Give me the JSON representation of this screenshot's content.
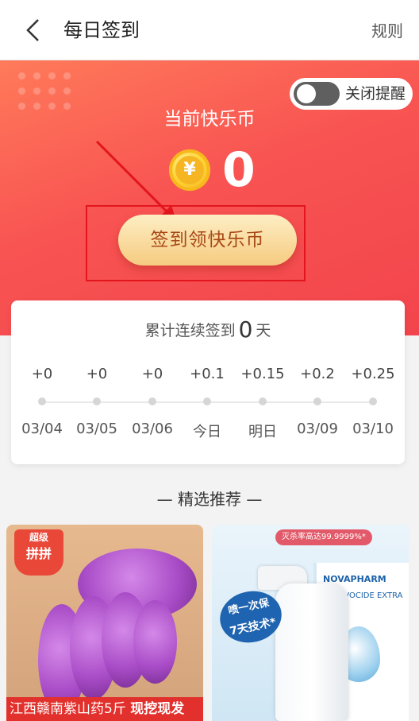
{
  "header": {
    "title": "每日签到",
    "rules_label": "规则"
  },
  "hero": {
    "remind_label": "关闭提醒",
    "remind_on": false,
    "balance_label": "当前快乐币",
    "coin_symbol": "¥",
    "balance": "0",
    "sign_button_label": "签到领快乐币"
  },
  "streak": {
    "prefix": "累计连续签到",
    "count": "0",
    "suffix": "天"
  },
  "schedule": [
    {
      "bonus": "+0",
      "date": "03/04"
    },
    {
      "bonus": "+0",
      "date": "03/05"
    },
    {
      "bonus": "+0",
      "date": "03/06"
    },
    {
      "bonus": "+0.1",
      "date": "今日"
    },
    {
      "bonus": "+0.15",
      "date": "明日"
    },
    {
      "bonus": "+0.2",
      "date": "03/09"
    },
    {
      "bonus": "+0.25",
      "date": "03/10"
    }
  ],
  "recommend": {
    "title": "— 精选推荐 —",
    "products": [
      {
        "badge_line1": "超级",
        "badge_line2": "拼拼",
        "caption": "江西赣南紫山药5斤",
        "caption_tag": "现挖现发"
      },
      {
        "brand": "NOVAPHARM",
        "box_text": "EVOCIDE EXTRA",
        "top_tag": "灭杀率高达99.9999%*",
        "bubble_line1": "喷一次保",
        "bubble_line2": "7天技术*"
      }
    ]
  },
  "colors": {
    "hero_red": "#f2444c",
    "button_gold": "#f6cb80",
    "highlight_box": "#e3161d"
  }
}
